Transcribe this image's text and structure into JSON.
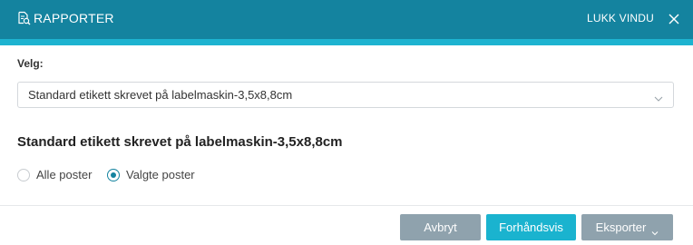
{
  "header": {
    "title": "RAPPORTER",
    "title_icon": "report-search-icon",
    "close_label": "LUKK VINDU",
    "close_icon": "close-icon",
    "colors": {
      "bar": "#14839f",
      "accent": "#1db3d0"
    }
  },
  "form": {
    "select_label": "Velg:",
    "select_value": "Standard etikett skrevet på labelmaskin-3,5x8,8cm",
    "select_icon": "chevron-down-icon"
  },
  "report": {
    "title": "Standard etikett skrevet på labelmaskin-3,5x8,8cm"
  },
  "options": [
    {
      "label": "Alle poster",
      "checked": false
    },
    {
      "label": "Valgte poster",
      "checked": true
    }
  ],
  "footer": {
    "cancel_label": "Avbryt",
    "preview_label": "Forhåndsvis",
    "export_label": "Eksporter",
    "export_icon": "chevron-down-icon",
    "colors": {
      "primary": "#1ab3cf",
      "secondary": "#8fa2ad"
    }
  }
}
